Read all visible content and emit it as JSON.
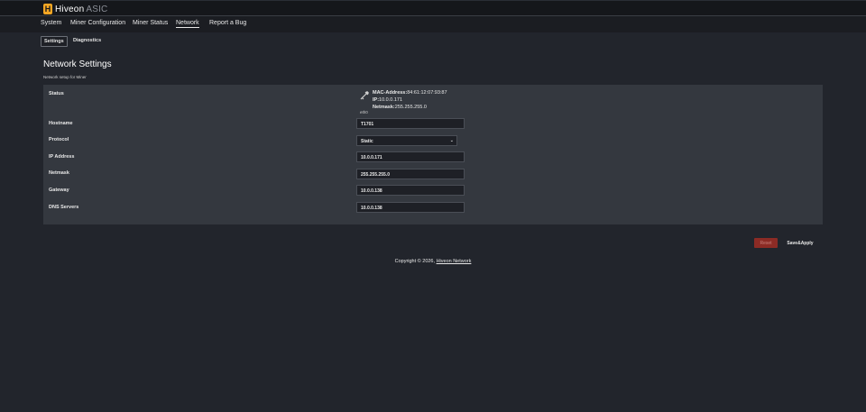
{
  "brand": {
    "mark": "H",
    "name": "Hiveon",
    "suffix": "ASIC",
    "accent": "#f5a623"
  },
  "main_nav": {
    "items": [
      {
        "label": "System"
      },
      {
        "label": "Miner Configuration"
      },
      {
        "label": "Miner Status"
      },
      {
        "label": "Network",
        "active": true
      },
      {
        "label": "Report a Bug"
      }
    ]
  },
  "sub_nav": {
    "tabs": [
      {
        "label": "Settings",
        "active": true
      },
      {
        "label": "Diagnostics"
      }
    ]
  },
  "page": {
    "title": "Network Settings",
    "description": "Network setup for Miner"
  },
  "status": {
    "label": "Status",
    "interface_icon": "ethernet-port-icon",
    "interface": "eth0",
    "mac_label": "MAC-Address:",
    "mac_value": "84:61:12:07:93:87",
    "ip_label": "IP:",
    "ip_value": "10.0.0.171",
    "netmask_label": "Netmask:",
    "netmask_value": "255.255.255.0"
  },
  "form": {
    "hostname": {
      "label": "Hostname",
      "value": "T1701"
    },
    "protocol": {
      "label": "Protocol",
      "value": "Static"
    },
    "ip_address": {
      "label": "IP Address",
      "value": "10.0.0.171"
    },
    "netmask": {
      "label": "Netmask",
      "value": "255.255.255.0"
    },
    "gateway": {
      "label": "Gateway",
      "value": "10.0.0.138"
    },
    "dns_servers": {
      "label": "DNS Servers",
      "value": "10.0.0.138"
    }
  },
  "actions": {
    "reset_label": "Reset",
    "save_label": "Save&Apply",
    "reset_color": "#8c2b25"
  },
  "footer": {
    "copyright": "Copyright © 2026,",
    "link": "Hiveon Network"
  }
}
